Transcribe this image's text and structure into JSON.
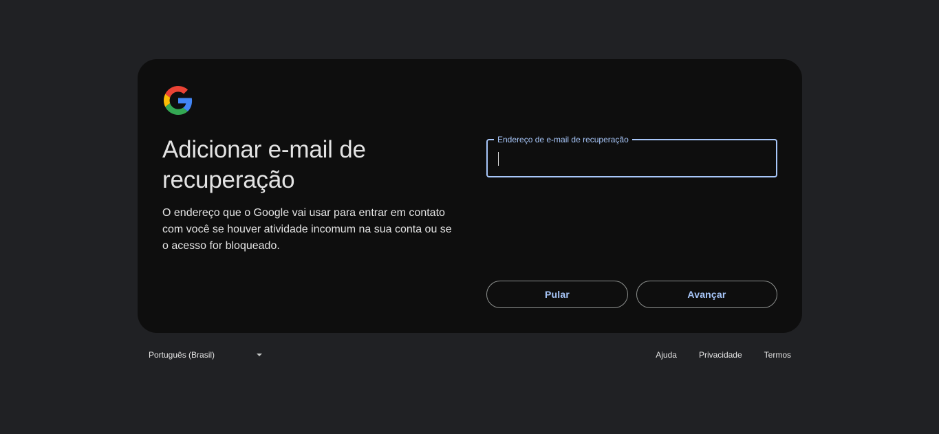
{
  "header": {
    "logo_icon": "google-g-logo-icon"
  },
  "main": {
    "title": "Adicionar e-mail de recuperação",
    "description": "O endereço que o Google vai usar para entrar em contato com você se houver atividade incomum na sua conta ou se o acesso for bloqueado.",
    "recovery_email": {
      "label": "Endereço de e-mail de recuperação",
      "value": "",
      "focused": true
    },
    "buttons": {
      "skip_label": "Pular",
      "next_label": "Avançar"
    }
  },
  "footer": {
    "language": "Português (Brasil)",
    "language_icon": "dropdown-arrow-icon",
    "links": {
      "help": "Ajuda",
      "privacy": "Privacidade",
      "terms": "Termos"
    }
  },
  "colors": {
    "page_background": "#202124",
    "card_background": "#0e0e0e",
    "accent": "#a8c7fa",
    "text": "#e3e3e3",
    "google_blue": "#4285F4",
    "google_red": "#EA4335",
    "google_yellow": "#FBBC05",
    "google_green": "#34A853"
  }
}
